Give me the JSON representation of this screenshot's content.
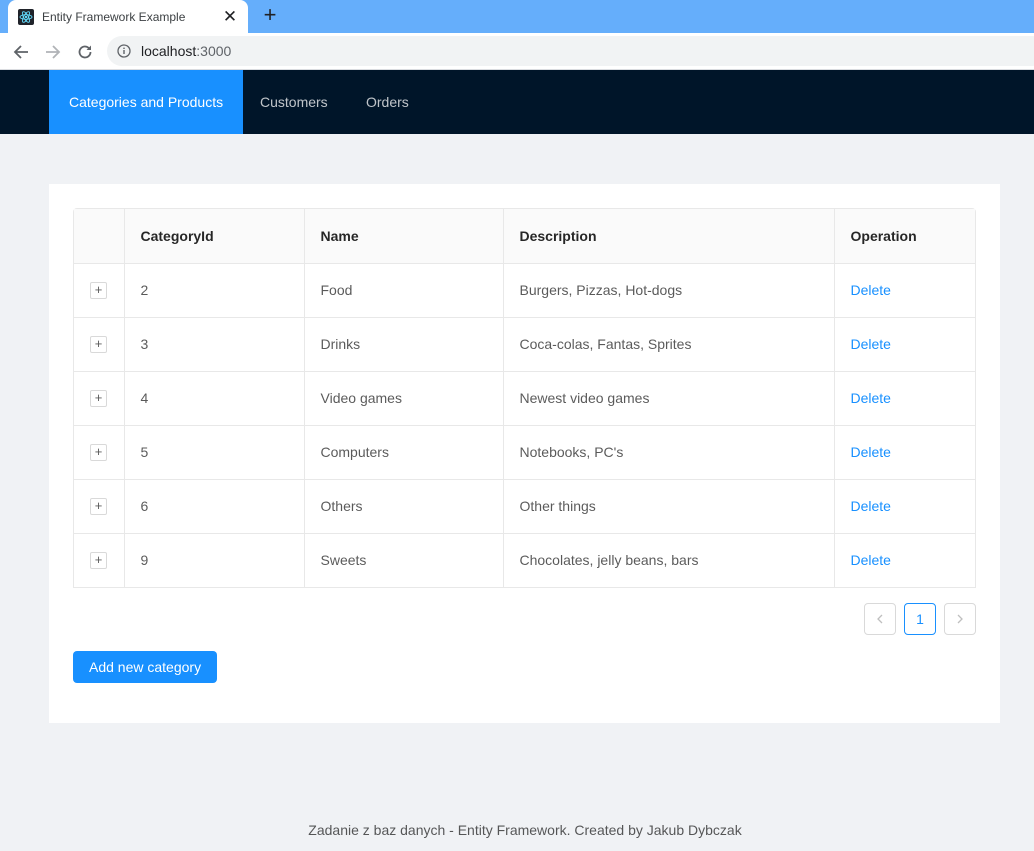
{
  "browser": {
    "tab_title": "Entity Framework Example",
    "url_host": "localhost",
    "url_port": ":3000",
    "icons": {
      "favicon": "react-logo-icon",
      "close": "close-icon",
      "new_tab": "plus-icon",
      "back": "arrow-left-icon",
      "forward": "arrow-right-icon",
      "reload": "reload-icon",
      "info": "info-icon"
    }
  },
  "nav": {
    "items": [
      {
        "label": "Categories and Products",
        "active": true
      },
      {
        "label": "Customers",
        "active": false
      },
      {
        "label": "Orders",
        "active": false
      }
    ]
  },
  "table": {
    "columns": [
      "CategoryId",
      "Name",
      "Description",
      "Operation"
    ],
    "rows": [
      {
        "id": "2",
        "name": "Food",
        "description": "Burgers, Pizzas, Hot-dogs",
        "operation": "Delete"
      },
      {
        "id": "3",
        "name": "Drinks",
        "description": "Coca-colas, Fantas, Sprites",
        "operation": "Delete"
      },
      {
        "id": "4",
        "name": "Video games",
        "description": "Newest video games",
        "operation": "Delete"
      },
      {
        "id": "5",
        "name": "Computers",
        "description": "Notebooks, PC's",
        "operation": "Delete"
      },
      {
        "id": "6",
        "name": "Others",
        "description": "Other things",
        "operation": "Delete"
      },
      {
        "id": "9",
        "name": "Sweets",
        "description": "Chocolates, jelly beans, bars",
        "operation": "Delete"
      }
    ],
    "expand_symbol": "+"
  },
  "pagination": {
    "current_page": "1"
  },
  "add_button_label": "Add new category",
  "footer_text": "Zadanie z baz danych - Entity Framework. Created by Jakub Dybczak",
  "colors": {
    "primary": "#1890ff",
    "header_bg": "#001529",
    "tabstrip": "#65aefb",
    "page_bg": "#f0f2f5"
  }
}
